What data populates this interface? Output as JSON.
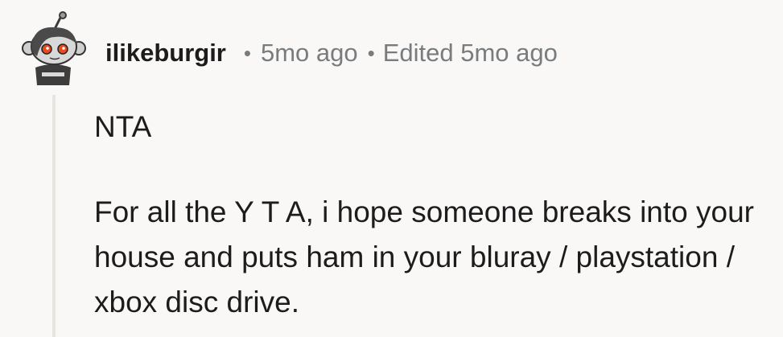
{
  "comment": {
    "username": "ilikeburgir",
    "separator": "•",
    "posted": "5mo ago",
    "edited": "Edited 5mo ago",
    "avatar_icon": "snoo-avatar-icon",
    "paragraphs": [
      "NTA",
      "For all the Y T A, i hope someone breaks into your house and puts ham in your bluray / playstation / xbox disc drive."
    ]
  },
  "colors": {
    "background": "#f9f8f7",
    "text": "#1c1c1c",
    "meta": "#787c7e",
    "thread_line": "#e8e4e0",
    "avatar_eyes": "#e8491d"
  }
}
